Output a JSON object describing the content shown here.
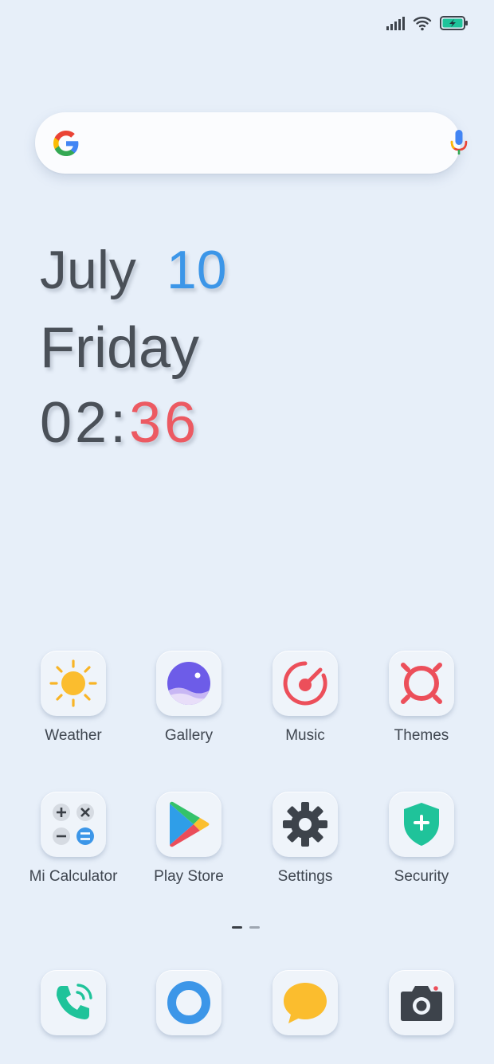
{
  "status_bar": {
    "icons": [
      "signal-icon",
      "wifi-icon",
      "battery-charging-icon"
    ],
    "battery_color": "#1fc39a"
  },
  "search": {
    "icons": [
      "google-g-icon",
      "microphone-icon"
    ]
  },
  "clock": {
    "month": "July",
    "day": "10",
    "weekday": "Friday",
    "hours": "02",
    "separator": ":",
    "minutes": "36",
    "day_color": "#3c96e8",
    "minutes_color": "#ec5a62"
  },
  "apps": [
    {
      "label": "Weather",
      "icon": "sun-icon"
    },
    {
      "label": "Gallery",
      "icon": "gallery-icon"
    },
    {
      "label": "Music",
      "icon": "music-icon"
    },
    {
      "label": "Themes",
      "icon": "themes-icon"
    },
    {
      "label": "Mi Calculator",
      "icon": "calculator-icon"
    },
    {
      "label": "Play Store",
      "icon": "play-store-icon"
    },
    {
      "label": "Settings",
      "icon": "gear-icon"
    },
    {
      "label": "Security",
      "icon": "shield-icon"
    }
  ],
  "dock": [
    {
      "icon": "phone-icon"
    },
    {
      "icon": "browser-icon"
    },
    {
      "icon": "messages-icon"
    },
    {
      "icon": "camera-icon"
    }
  ],
  "pages": {
    "count": 2,
    "current": 1
  }
}
